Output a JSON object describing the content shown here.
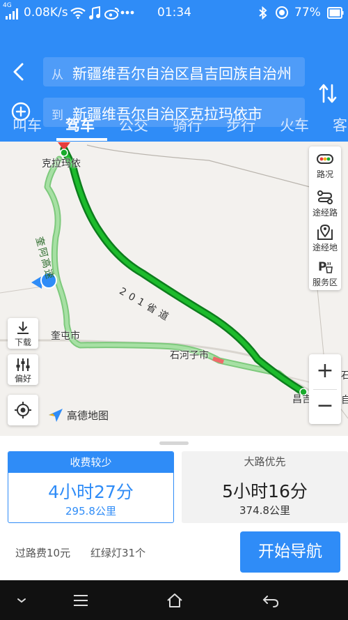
{
  "status_bar": {
    "signal_label": "4G",
    "net_speed": "0.08K/s",
    "icons": [
      "signal-icon",
      "wifi-icon",
      "music-icon",
      "weibo-icon",
      "more-icon",
      "bluetooth-icon",
      "alarm-icon",
      "battery-icon"
    ],
    "time": "01:34",
    "battery": "77%"
  },
  "header": {
    "from_prefix": "从",
    "from_value": "新疆维吾尔自治区昌吉回族自治州",
    "to_prefix": "到",
    "to_value": "新疆维吾尔自治区克拉玛依市"
  },
  "tabs": [
    {
      "label": "叫车",
      "active": false
    },
    {
      "label": "驾车",
      "active": true
    },
    {
      "label": "公交",
      "active": false
    },
    {
      "label": "骑行",
      "active": false
    },
    {
      "label": "步行",
      "active": false
    },
    {
      "label": "火车",
      "active": false
    },
    {
      "label": "客",
      "active": false
    }
  ],
  "map": {
    "labels": {
      "start_city": "克拉玛依",
      "city_kuitun": "奎屯市",
      "city_shihezi": "石河子市",
      "end_city": "昌吉",
      "edge_text_1": "石",
      "edge_text_2": "自"
    },
    "road_labels": {
      "main_route": "201省道",
      "alt_route": "奎阿高速"
    },
    "side_tools": [
      {
        "label": "路况",
        "icon": "traffic-icon"
      },
      {
        "label": "途经路",
        "icon": "route-via-icon"
      },
      {
        "label": "途经地",
        "icon": "map-pin-icon"
      },
      {
        "label": "服务区",
        "icon": "service-area-icon"
      }
    ],
    "zoom_in": "+",
    "zoom_out": "−",
    "download_label": "下载",
    "preference_label": "偏好",
    "logo_text": "高德地图"
  },
  "routes": [
    {
      "tag": "收费较少",
      "time": "4小时27分",
      "distance": "295.8公里",
      "selected": true
    },
    {
      "tag": "大路优先",
      "time": "5小时16分",
      "distance": "374.8公里",
      "selected": false
    }
  ],
  "summary": {
    "toll": "过路费10元",
    "lights": "红绿灯31个"
  },
  "start_button": "开始导航",
  "colors": {
    "brand": "#2f8cf7",
    "selected_route": "#1aab2c",
    "alt_route": "#8fd78e"
  }
}
